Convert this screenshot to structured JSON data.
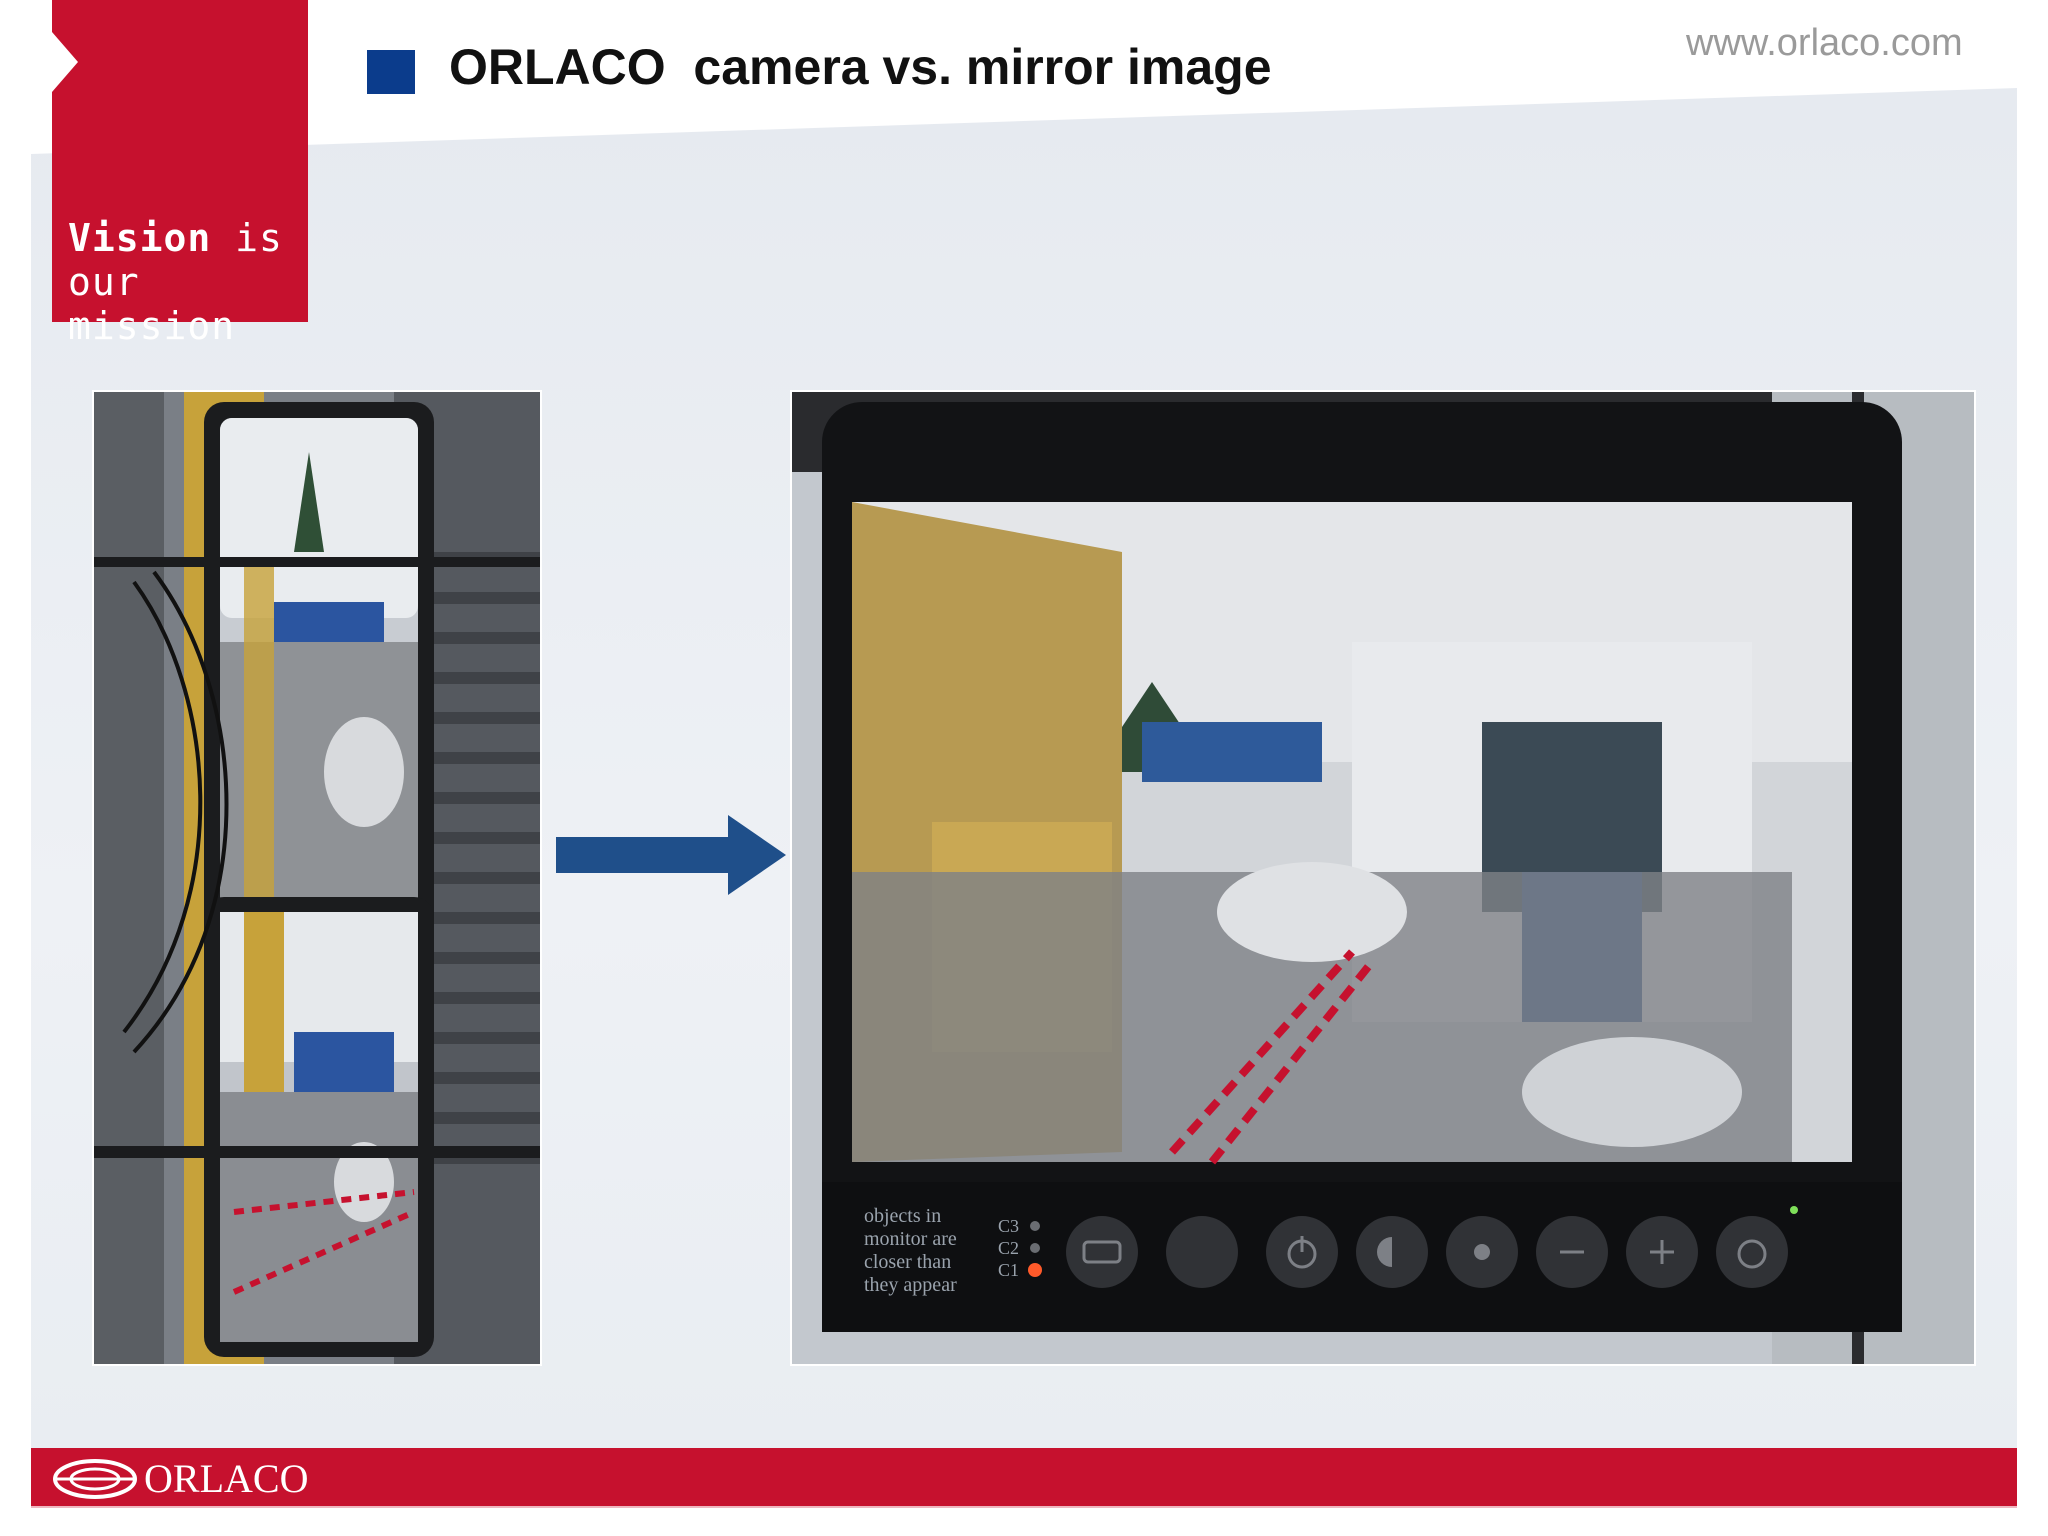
{
  "header": {
    "title": "ORLACO  camera vs. mirror image",
    "url": "www.orlaco.com",
    "tagline_line1_bold": "Vision",
    "tagline_line1_rest": " is",
    "tagline_line2": "our mission"
  },
  "monitor": {
    "warning_lines": [
      "objects   in",
      "monitor are",
      "closer   than",
      "they appear"
    ],
    "channels": [
      "C3",
      "C2",
      "C1"
    ]
  },
  "footer": {
    "brand": "ORLACO"
  },
  "colors": {
    "brand_red": "#c6112e",
    "bullet_blue": "#0b3c8c",
    "arrow_blue": "#1f4f8a"
  }
}
